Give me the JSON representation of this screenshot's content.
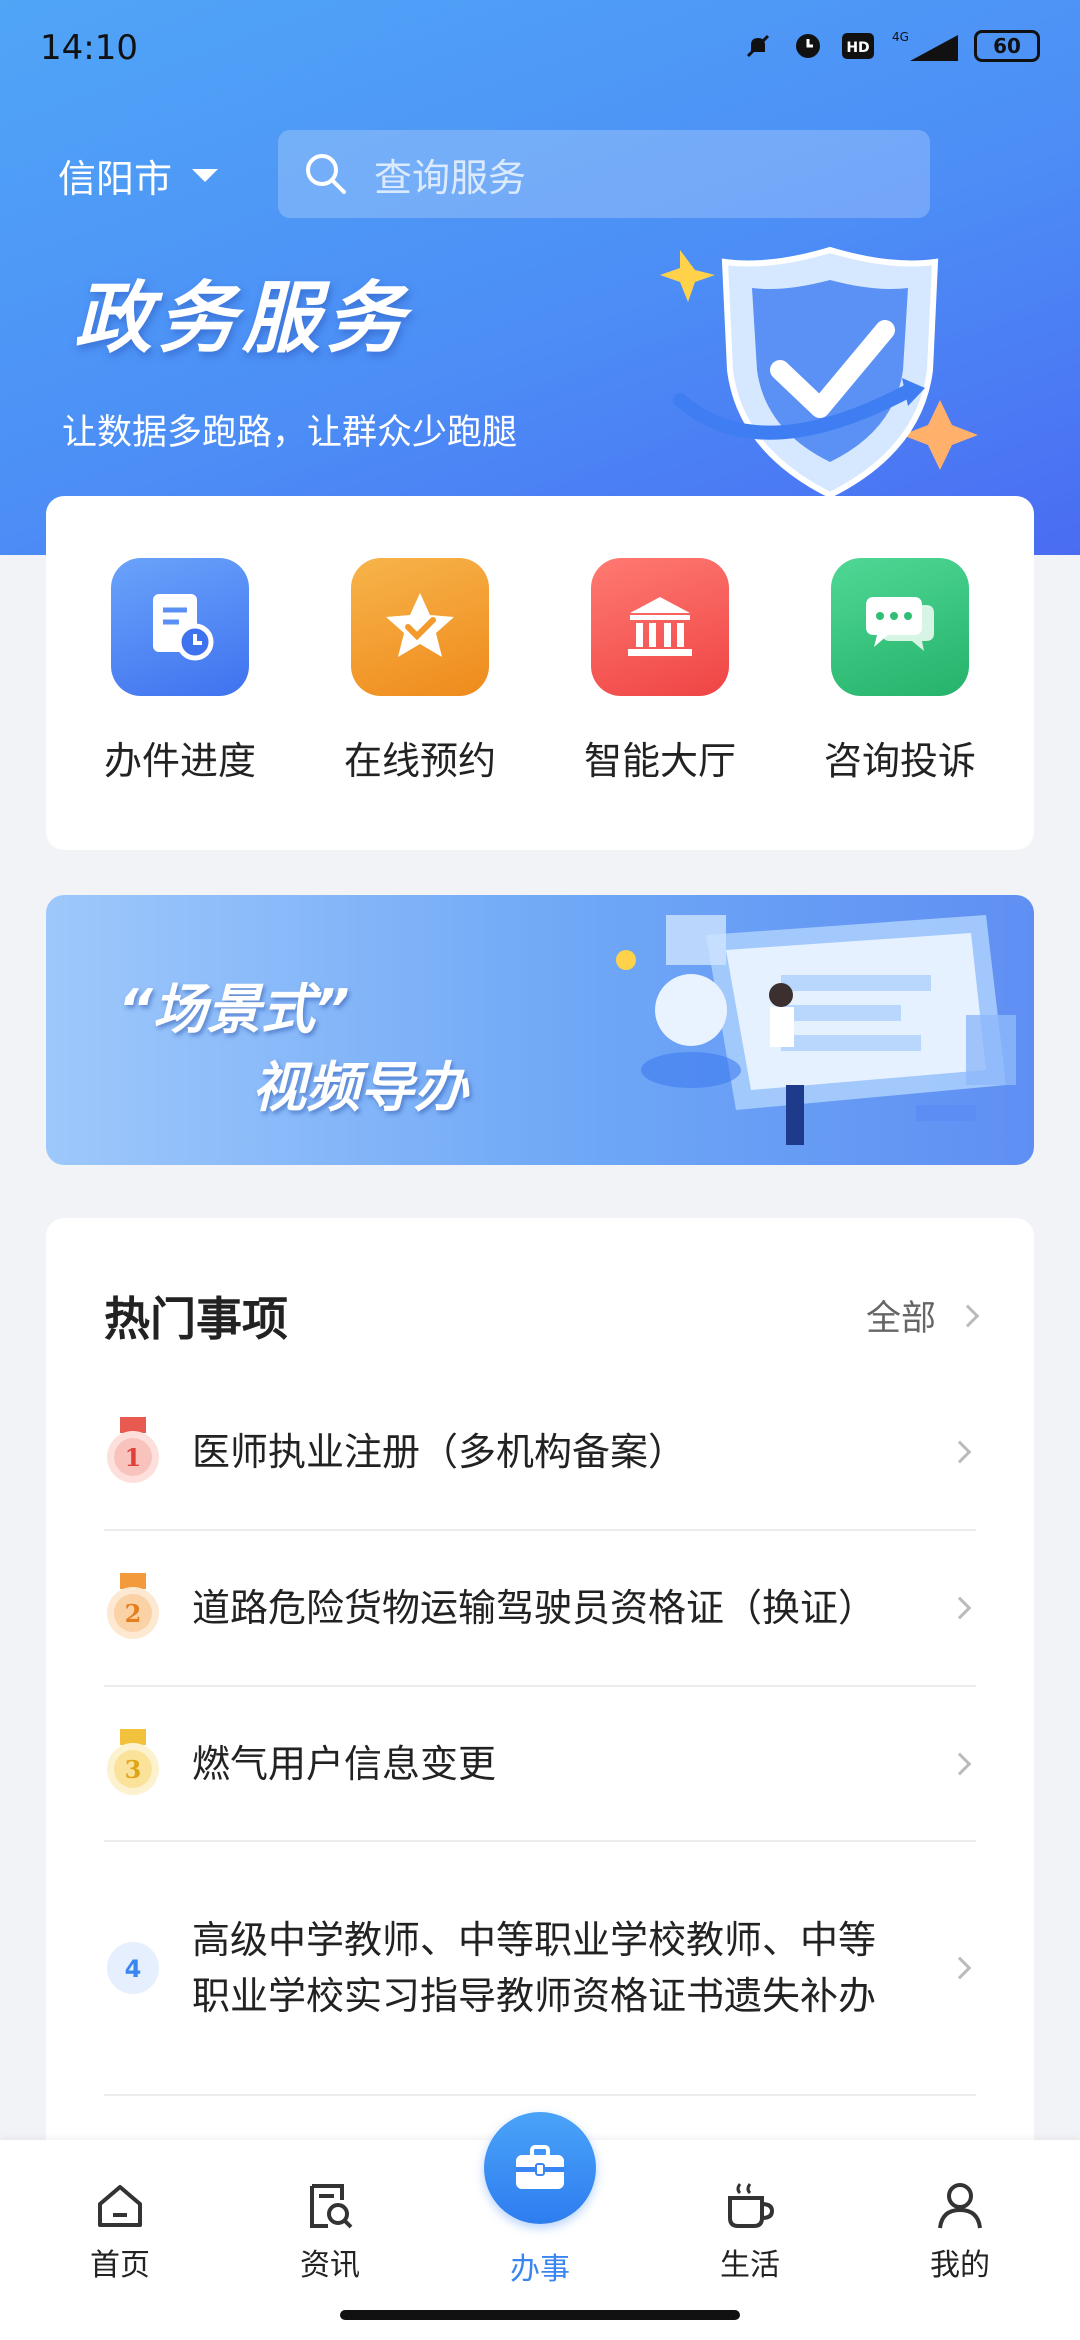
{
  "status_bar": {
    "time": "14:10",
    "battery": "60",
    "network": "4G"
  },
  "header": {
    "city": "信阳市",
    "search_placeholder": "查询服务",
    "title": "政务服务",
    "subtitle": "让数据多跑路，让群众少跑腿"
  },
  "quick_actions": [
    {
      "label": "办件进度",
      "icon": "document-clock-icon",
      "color": "#4f86f3"
    },
    {
      "label": "在线预约",
      "icon": "star-check-icon",
      "color": "#f39a2a"
    },
    {
      "label": "智能大厅",
      "icon": "building-icon",
      "color": "#f55a55"
    },
    {
      "label": "咨询投诉",
      "icon": "chat-bubble-icon",
      "color": "#33c27a"
    }
  ],
  "banner": {
    "line1": "“场景式”",
    "line2": "视频导办"
  },
  "hot": {
    "title": "热门事项",
    "all_label": "全部",
    "items": [
      {
        "rank": "1",
        "text": "医师执业注册（多机构备案）"
      },
      {
        "rank": "2",
        "text": "道路危险货物运输驾驶员资格证（换证）"
      },
      {
        "rank": "3",
        "text": "燃气用户信息变更"
      },
      {
        "rank": "4",
        "text": "高级中学教师、中等职业学校教师、中等职业学校实习指导教师资格证书遗失补办"
      }
    ]
  },
  "tabs": [
    {
      "label": "首页",
      "icon": "home-icon"
    },
    {
      "label": "资讯",
      "icon": "news-search-icon"
    },
    {
      "label": "办事",
      "icon": "briefcase-icon",
      "active": true
    },
    {
      "label": "生活",
      "icon": "coffee-cup-icon"
    },
    {
      "label": "我的",
      "icon": "person-icon"
    }
  ],
  "colors": {
    "accent": "#3a86f0",
    "hero_top": "#50a5f7",
    "hero_bottom": "#4a6cf2"
  }
}
